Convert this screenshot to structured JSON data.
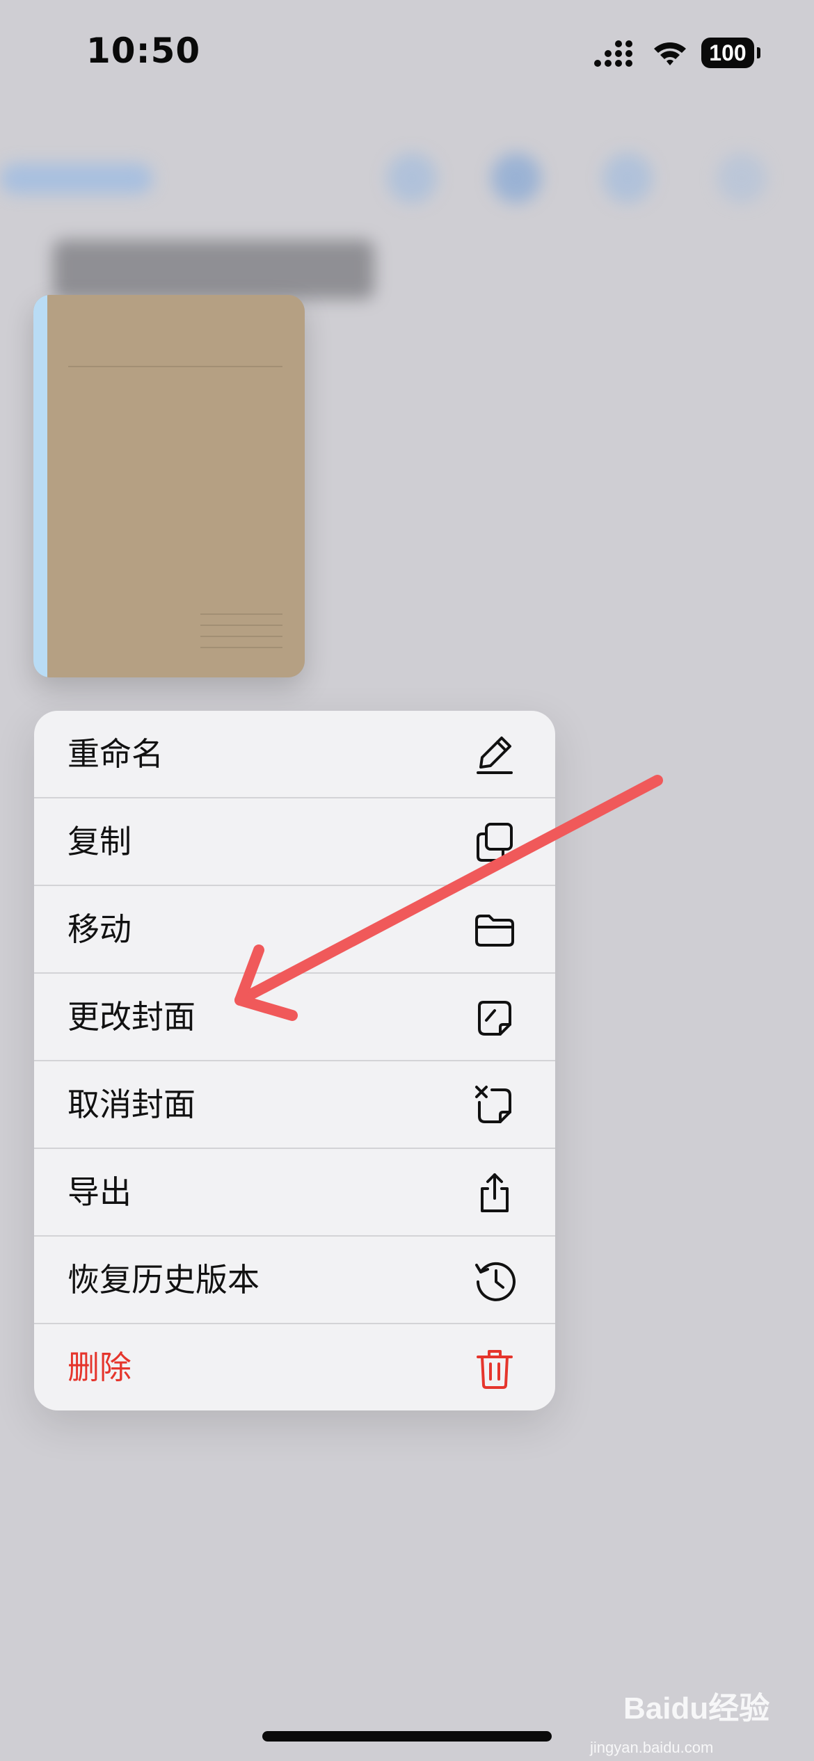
{
  "status_bar": {
    "time": "10:50",
    "battery": "100"
  },
  "notebook": {
    "cover_color": "#b5a083",
    "spine_color": "#b9dcf5"
  },
  "menu": {
    "items": [
      {
        "label": "重命名",
        "icon": "pencil-icon"
      },
      {
        "label": "复制",
        "icon": "duplicate-icon"
      },
      {
        "label": "移动",
        "icon": "folder-icon"
      },
      {
        "label": "更改封面",
        "icon": "change-cover-icon"
      },
      {
        "label": "取消封面",
        "icon": "remove-cover-icon"
      },
      {
        "label": "导出",
        "icon": "share-icon"
      },
      {
        "label": "恢复历史版本",
        "icon": "history-icon"
      },
      {
        "label": "删除",
        "icon": "trash-icon",
        "color": "#e5352c"
      }
    ]
  },
  "annotation": {
    "arrow_color": "#f0595a"
  },
  "watermark": {
    "brand": "Baidu经验",
    "url": "jingyan.baidu.com"
  }
}
